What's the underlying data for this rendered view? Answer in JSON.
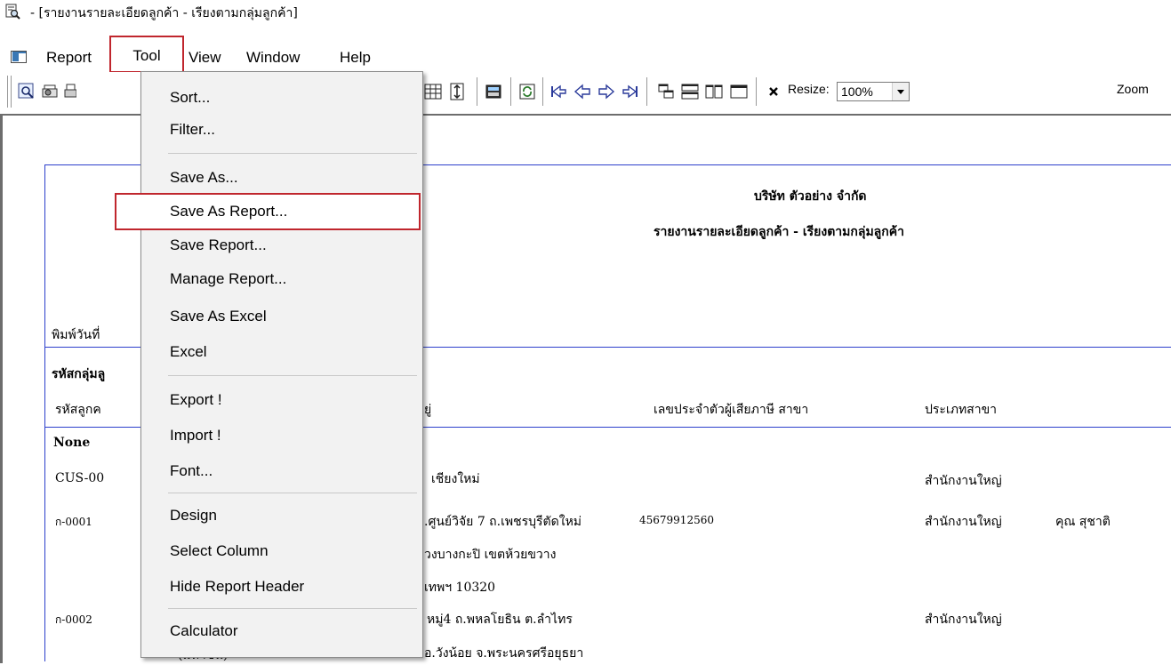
{
  "window": {
    "title": "- [รายงานรายละเอียดลูกค้า - เรียงตามกลุ่มลูกค้า]"
  },
  "menubar": [
    "Report",
    "Tool",
    "View",
    "Window",
    "Help"
  ],
  "toolbar": {
    "resize_label": "Resize:",
    "resize_value": "100%",
    "zoom_label": "Zoom"
  },
  "dropdown": {
    "items": [
      "Sort...",
      "Filter...",
      "Save As...",
      "Save As Report...",
      "Save Report...",
      "Manage Report...",
      "Save As Excel",
      "Excel",
      "Export !",
      "Import !",
      "Font...",
      "Design",
      "Select Column",
      "Hide Report Header",
      "Calculator"
    ],
    "highlighted": "Save As Report..."
  },
  "report": {
    "company": "บริษัท ตัวอย่าง จำกัด",
    "title": "รายงานรายละเอียดลูกค้า - เรียงตามกลุ่มลูกค้า",
    "print_date_label": "พิมพ์วันที่",
    "group_code_label": "รหัสกลุ่มลู",
    "col_code": "รหัสลูกค",
    "col_address": "ยู่",
    "col_taxid": "เลขประจำตัวผู้เสียภาษี สาขา",
    "col_branch_type": "ประเภทสาขา",
    "group_none": "None",
    "rows": [
      {
        "code": "CUS-00",
        "addr": "เชียงใหม่",
        "tax": "",
        "branch": "สำนักงานใหญ่",
        "contact": ""
      },
      {
        "code": "ก-0001",
        "addr": ".ศูนย์วิจัย 7 ถ.เพชรบุรีตัดใหม่",
        "tax": "45679912560",
        "branch": "สำนักงานใหญ่",
        "contact": "คุณ สุชาติ"
      },
      {
        "code": "",
        "addr": "วงบางกะปิ เขตห้วยขวาง",
        "tax": "",
        "branch": "",
        "contact": ""
      },
      {
        "code": "",
        "addr": "เทพฯ 10320",
        "tax": "",
        "branch": "",
        "contact": ""
      },
      {
        "code": "ก-0002",
        "addr": "หมู่4 ถ.พหลโยธิน ต.ลำไทร",
        "tax": "",
        "branch": "สำนักงานใหญ่",
        "contact": ""
      },
      {
        "code": "(มหาชน)",
        "addr": "อ.วังน้อย จ.พระนครศรีอยุธยา",
        "tax": "",
        "branch": "",
        "contact": ""
      }
    ]
  }
}
